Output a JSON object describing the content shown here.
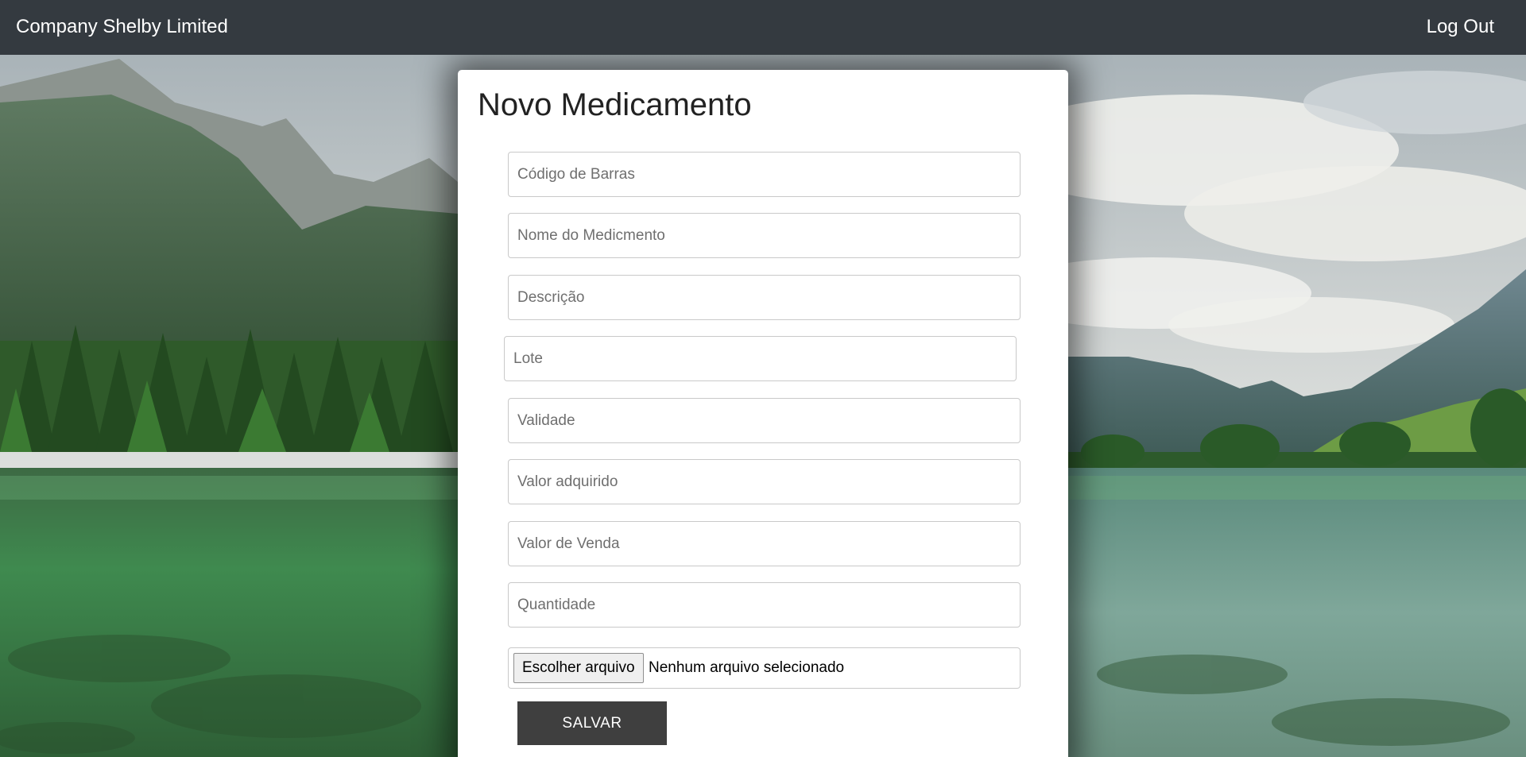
{
  "navbar": {
    "brand": "Company Shelby Limited",
    "logout_label": "Log Out",
    "background": "#343a40"
  },
  "form": {
    "title": "Novo Medicamento",
    "fields": [
      {
        "name": "barcode",
        "placeholder": "Código de Barras",
        "value": ""
      },
      {
        "name": "medicine_name",
        "placeholder": "Nome do Medicmento",
        "value": ""
      },
      {
        "name": "description",
        "placeholder": "Descrição",
        "value": ""
      },
      {
        "name": "batch",
        "placeholder": "Lote",
        "value": ""
      },
      {
        "name": "expiry",
        "placeholder": "Validade",
        "value": ""
      },
      {
        "name": "purchase_value",
        "placeholder": "Valor adquirido",
        "value": ""
      },
      {
        "name": "sale_value",
        "placeholder": "Valor de Venda",
        "value": ""
      },
      {
        "name": "quantity",
        "placeholder": "Quantidade",
        "value": ""
      }
    ],
    "file_button_label": "Escolher arquivo",
    "file_status": "Nenhum arquivo selecionado",
    "save_label": "SALVAR",
    "save_color": "#3f3f3f"
  },
  "background": {
    "description_icon": "mountain-lake-landscape"
  }
}
